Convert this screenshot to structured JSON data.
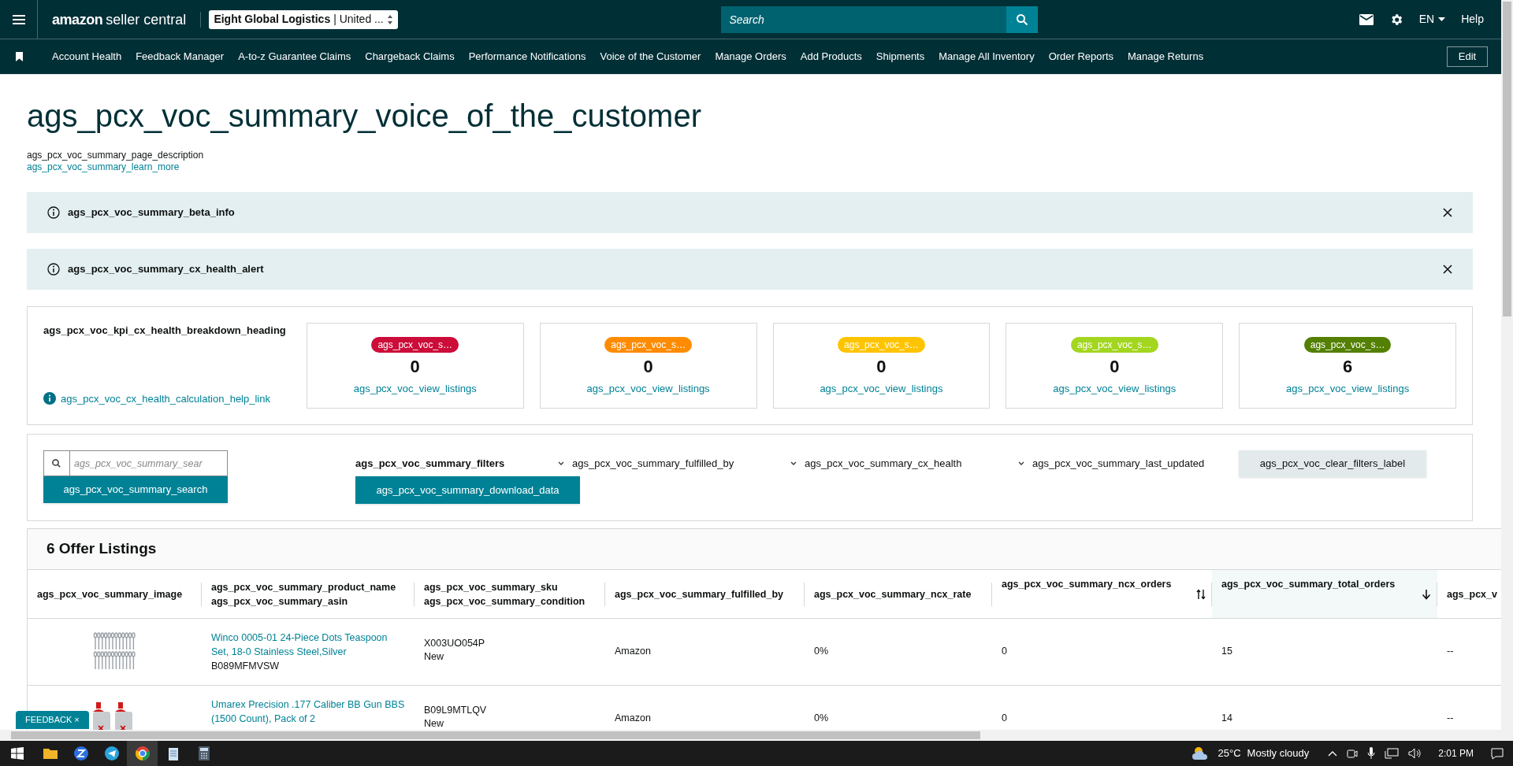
{
  "top_bar": {
    "logo": {
      "brand": "amazon",
      "product": "seller central"
    },
    "account_selector": {
      "name": "Eight Global Logistics",
      "region": "| United ..."
    },
    "search": {
      "placeholder": "Search"
    },
    "language": "EN",
    "help": "Help"
  },
  "nav": {
    "items": [
      "Account Health",
      "Feedback Manager",
      "A-to-z Guarantee Claims",
      "Chargeback Claims",
      "Performance Notifications",
      "Voice of the Customer",
      "Manage Orders",
      "Add Products",
      "Shipments",
      "Manage All Inventory",
      "Order Reports",
      "Manage Returns"
    ],
    "edit": "Edit"
  },
  "page": {
    "title": "ags_pcx_voc_summary_voice_of_the_customer",
    "description": "ags_pcx_voc_summary_page_description",
    "learn_more": "ags_pcx_voc_summary_learn_more"
  },
  "alerts": [
    {
      "text": "ags_pcx_voc_summary_beta_info"
    },
    {
      "text": "ags_pcx_voc_summary_cx_health_alert"
    }
  ],
  "kpi": {
    "heading": "ags_pcx_voc_kpi_cx_health_breakdown_heading",
    "help_link": "ags_pcx_voc_cx_health_calculation_help_link",
    "cards": [
      {
        "badge": "ags_pcx_voc_s…",
        "color": "#cc0c39",
        "count": "0",
        "link": "ags_pcx_voc_view_listings"
      },
      {
        "badge": "ags_pcx_voc_s…",
        "color": "#ff8c00",
        "count": "0",
        "link": "ags_pcx_voc_view_listings"
      },
      {
        "badge": "ags_pcx_voc_s…",
        "color": "#ffc400",
        "count": "0",
        "link": "ags_pcx_voc_view_listings"
      },
      {
        "badge": "ags_pcx_voc_s…",
        "color": "#a3d61f",
        "count": "0",
        "link": "ags_pcx_voc_view_listings"
      },
      {
        "badge": "ags_pcx_voc_s…",
        "color": "#538000",
        "count": "6",
        "link": "ags_pcx_voc_view_listings"
      }
    ]
  },
  "filters": {
    "search_placeholder": "ags_pcx_voc_summary_sear",
    "search_button": "ags_pcx_voc_summary_search",
    "label": "ags_pcx_voc_summary_filters",
    "download_button": "ags_pcx_voc_summary_download_data",
    "dropdowns": [
      "ags_pcx_voc_summary_fulfilled_by",
      "ags_pcx_voc_summary_cx_health",
      "ags_pcx_voc_summary_last_updated"
    ],
    "clear_button": "ags_pcx_voc_clear_filters_label"
  },
  "table": {
    "title": "6 Offer Listings",
    "columns": [
      {
        "lines": [
          "ags_pcx_voc_summary_image"
        ],
        "sortable": false,
        "selected": false
      },
      {
        "lines": [
          "ags_pcx_voc_summary_product_name",
          "ags_pcx_voc_summary_asin"
        ],
        "sortable": false,
        "selected": false
      },
      {
        "lines": [
          "ags_pcx_voc_summary_sku",
          "ags_pcx_voc_summary_condition"
        ],
        "sortable": false,
        "selected": false
      },
      {
        "lines": [
          "ags_pcx_voc_summary_fulfilled_by"
        ],
        "sortable": false,
        "selected": false
      },
      {
        "lines": [
          "ags_pcx_voc_summary_ncx_rate"
        ],
        "sortable": false,
        "selected": false
      },
      {
        "lines": [
          "ags_pcx_voc_summary_ncx_orders"
        ],
        "sortable": true,
        "selected": false
      },
      {
        "lines": [
          "ags_pcx_voc_summary_total_orders"
        ],
        "sortable": true,
        "selected": true
      },
      {
        "lines": [
          "ags_pcx_v"
        ],
        "sortable": false,
        "selected": false
      }
    ],
    "rows": [
      {
        "image": {
          "kind": "spoons"
        },
        "product_name": "Winco 0005-01 24-Piece Dots Teaspoon Set, 18-0 Stainless Steel,Silver",
        "asin": "B089MFMVSW",
        "sku": "X003UO054P",
        "condition": "New",
        "fulfilled_by": "Amazon",
        "ncx_rate": "0%",
        "ncx_orders": "0",
        "total_orders": "15",
        "column_8": "--"
      },
      {
        "image": {
          "kind": "bottles"
        },
        "product_name": "Umarex Precision .177 Caliber BB Gun BBS (1500 Count), Pack of 2",
        "sku": "B09L9MTLQV",
        "condition": "New",
        "fulfilled_by": "Amazon",
        "ncx_rate": "0%",
        "ncx_orders": "0",
        "total_orders": "14",
        "column_8": "--"
      }
    ]
  },
  "feedback": {
    "label": "FEEDBACK ×"
  },
  "taskbar": {
    "weather": {
      "temperature": "25°C",
      "condition": "Mostly cloudy"
    },
    "time": "2:01 PM"
  }
}
